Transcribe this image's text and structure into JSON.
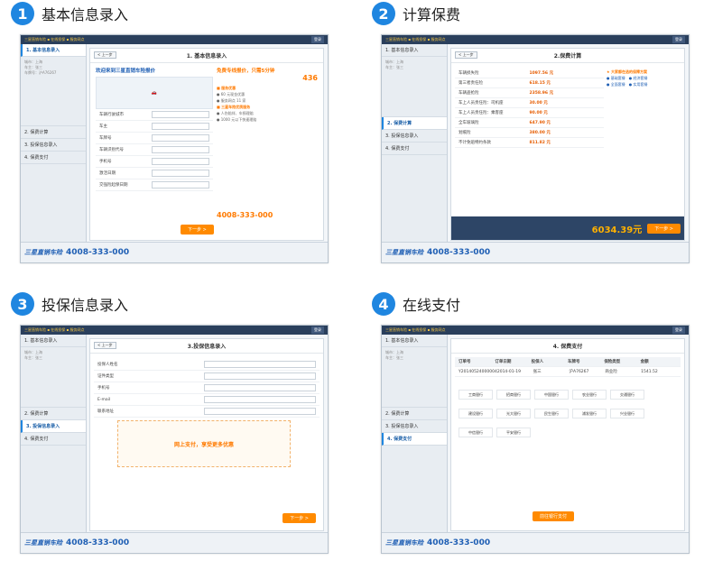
{
  "steps": [
    {
      "num": "1",
      "title": "基本信息录入",
      "panel": "1. 基本信息录入"
    },
    {
      "num": "2",
      "title": "计算保费",
      "panel": "2.保费计算"
    },
    {
      "num": "3",
      "title": "投保信息录入",
      "panel": "3.投保信息录入"
    },
    {
      "num": "4",
      "title": "在线支付",
      "panel": "4. 保费支付"
    }
  ],
  "common": {
    "back": "< 上一步",
    "brand": "三星直销车险",
    "hotline": "4008-333-000",
    "sidebar": [
      "1. 基本信息录入",
      "2. 保费计算",
      "3. 投保信息录入",
      "4. 保费支付"
    ],
    "next": "下一步 >"
  },
  "s1": {
    "welcome": "欢迎来到三星直销车险报价",
    "promo": "免费专线报价，只需5分钟",
    "count": "436",
    "hotline": "4008-333-000",
    "fields": [
      "车辆行驶城市",
      "车主",
      "车牌号",
      "车辆识别代号",
      "手机号",
      "激活日期",
      "交强险起保日期"
    ]
  },
  "s2": {
    "total": "6034.39元",
    "rows": [
      {
        "name": "车辆损失险",
        "price": "1097.56 元"
      },
      {
        "name": "第三者责任险",
        "price": "618.15 元"
      },
      {
        "name": "车辆盗抢险",
        "price": "2358.96 元"
      },
      {
        "name": "车上人员责任险：司机座",
        "price": "30.00 元"
      },
      {
        "name": "车上人员责任险：乘客座",
        "price": "90.00 元"
      },
      {
        "name": "全车玻璃险",
        "price": "647.90 元"
      },
      {
        "name": "划痕险",
        "price": "380.00 元"
      },
      {
        "name": "不计免赔特约条款",
        "price": "811.82 元"
      }
    ]
  },
  "s3": {
    "promo": "网上支付，享受更多优惠",
    "fields": [
      "投保人姓名",
      "证件类型",
      "手机号",
      "E-mail",
      "联系地址"
    ]
  },
  "s4": {
    "order_cols": [
      "订单号",
      "订单日期",
      "投保人",
      "车牌号",
      "保险类型",
      "金额"
    ],
    "order_vals": [
      "Y20140524000004",
      "2014-01-19",
      "张三",
      "沪A76267",
      "商业险",
      "1541.52"
    ],
    "banks": [
      "工商银行",
      "招商银行",
      "中国银行",
      "农业银行",
      "交通银行",
      "建设银行",
      "光大银行",
      "民生银行",
      "浦发银行",
      "兴业银行",
      "中信银行",
      "平安银行"
    ],
    "pay": "前往银行支付"
  }
}
